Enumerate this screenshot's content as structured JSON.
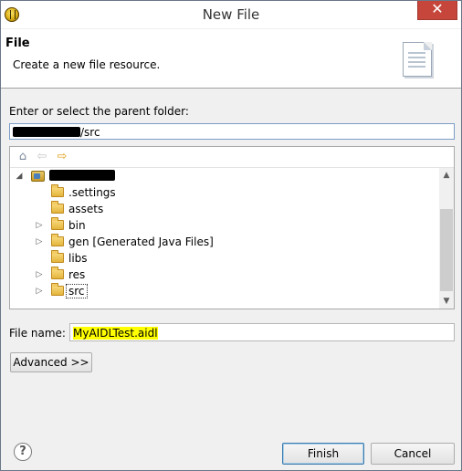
{
  "window": {
    "title": "New File",
    "close_glyph": "✕"
  },
  "header": {
    "title": "File",
    "description": "Create a new file resource."
  },
  "parent_folder": {
    "label": "Enter or select the parent folder:",
    "path_suffix": "/src"
  },
  "tree": {
    "toolbar": {
      "home": "⌂",
      "back": "⇦",
      "forward": "⇨"
    },
    "items": [
      {
        "label": "",
        "level": 0,
        "expanded": true,
        "type": "project",
        "redacted": true
      },
      {
        "label": ".settings",
        "level": 1,
        "has_children": false
      },
      {
        "label": "assets",
        "level": 1,
        "has_children": false
      },
      {
        "label": "bin",
        "level": 1,
        "has_children": true
      },
      {
        "label": "gen [Generated Java Files]",
        "level": 1,
        "has_children": true
      },
      {
        "label": "libs",
        "level": 1,
        "has_children": false
      },
      {
        "label": "res",
        "level": 1,
        "has_children": true
      },
      {
        "label": "src",
        "level": 1,
        "has_children": true,
        "selected": true
      }
    ],
    "scroll_up": "▲",
    "scroll_down": "▼"
  },
  "file_name": {
    "label": "File name:",
    "value": "MyAIDLTest.aidl"
  },
  "buttons": {
    "advanced": "Advanced >>",
    "finish": "Finish",
    "cancel": "Cancel"
  },
  "help": {
    "glyph": "?"
  },
  "colors": {
    "highlight": "#ffff00",
    "close": "#c7463b"
  }
}
